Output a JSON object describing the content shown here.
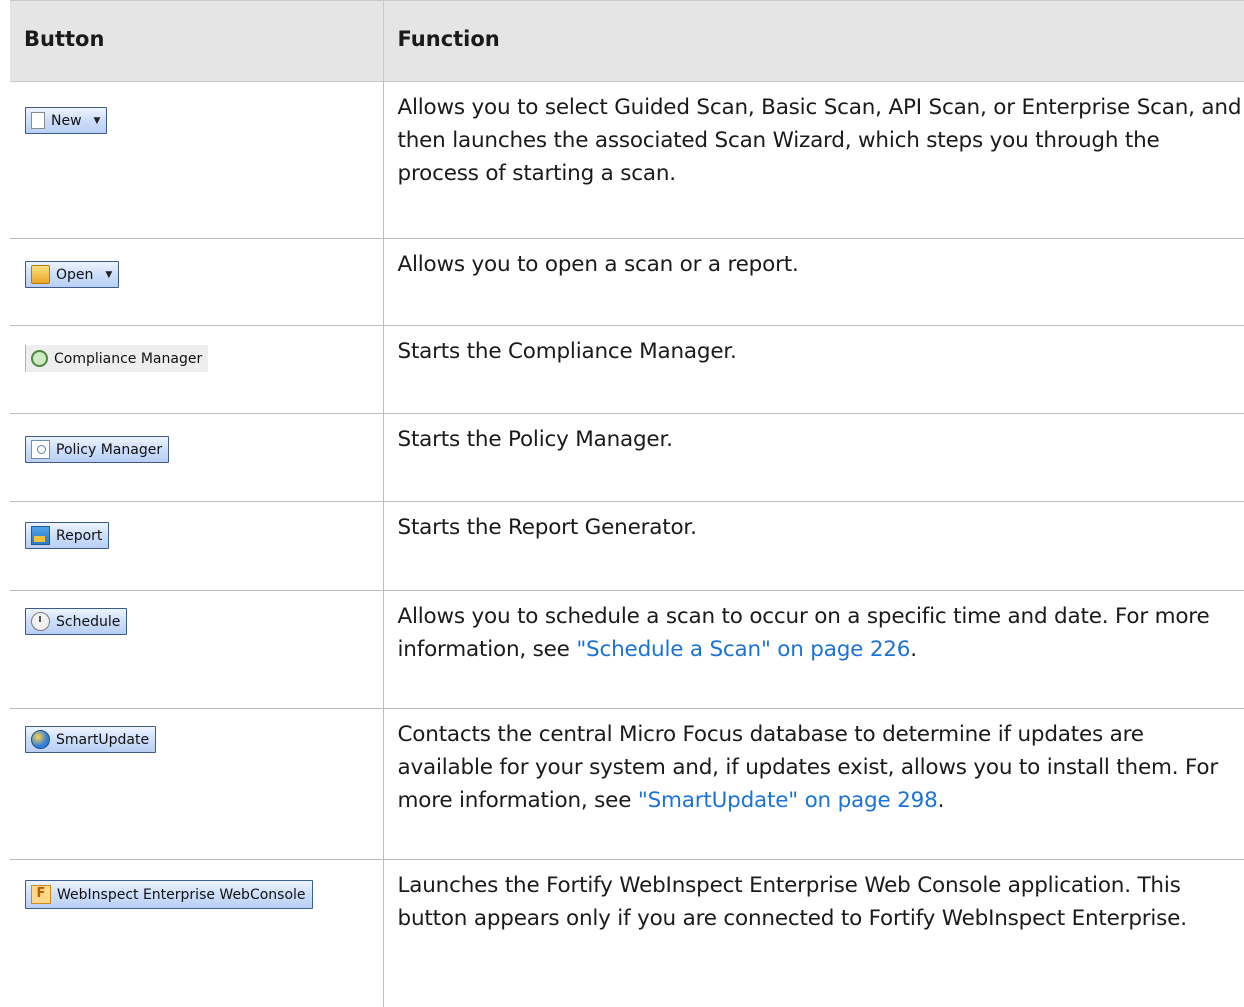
{
  "table": {
    "headers": [
      "Button",
      "Function"
    ],
    "rows": [
      {
        "button": {
          "label": "New",
          "icon": "new-document-icon",
          "dropdown": true
        },
        "function": "Allows you to select Guided Scan, Basic Scan, API Scan, or Enterprise Scan, and then launches the associated Scan Wizard, which steps you through the process of starting a scan."
      },
      {
        "button": {
          "label": "Open",
          "icon": "folder-open-icon",
          "dropdown": true
        },
        "function": "Allows you to open a scan or a report."
      },
      {
        "button": {
          "label": "Compliance Manager",
          "icon": "compliance-manager-icon"
        },
        "function": "Starts the Compliance Manager."
      },
      {
        "button": {
          "label": "Policy Manager",
          "icon": "policy-manager-icon"
        },
        "function": "Starts the Policy Manager."
      },
      {
        "button": {
          "label": "Report",
          "icon": "report-icon"
        },
        "function": "Starts the Report Generator."
      },
      {
        "button": {
          "label": "Schedule",
          "icon": "clock-icon"
        },
        "function_before": "Allows you to schedule a scan to occur on a specific time and date. For more information, see ",
        "function_link": "\"Schedule a Scan\" on page 226",
        "function_after": "."
      },
      {
        "button": {
          "label": "SmartUpdate",
          "icon": "smartupdate-icon"
        },
        "function_before": "Contacts the central Micro Focus database to determine if updates are available for your system and, if updates exist, allows you to install them. For more information, see ",
        "function_link": "\"SmartUpdate\" on page 298",
        "function_after": "."
      },
      {
        "button": {
          "label": "WebInspect Enterprise WebConsole",
          "icon": "fortify-f-icon",
          "icon_letter": "F"
        },
        "function": "Launches the Fortify WebInspect Enterprise Web Console application. This button appears only if you are connected to Fortify WebInspect Enterprise."
      }
    ]
  },
  "colors": {
    "header_bg": "#e5e5e5",
    "link": "#1a73d9"
  }
}
